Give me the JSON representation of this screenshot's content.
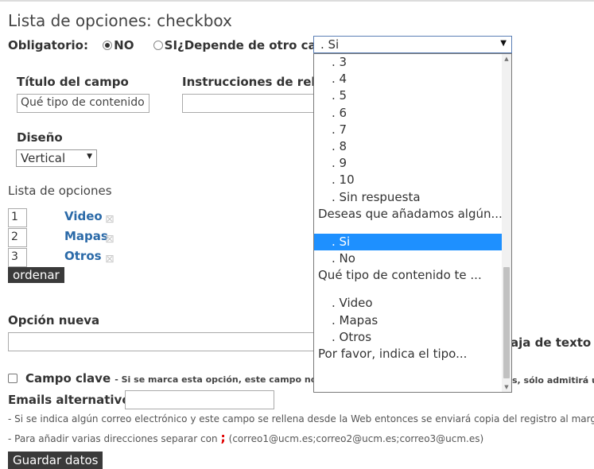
{
  "page": {
    "title": "Lista de opciones: checkbox"
  },
  "required": {
    "label": "Obligatorio:",
    "no_label": "NO",
    "si_label": "SI",
    "selected": "NO"
  },
  "depends": {
    "label": "¿Depende de otro campo?:",
    "selected": ". Si"
  },
  "field_title": {
    "label": "Título del campo",
    "value": "Qué tipo de contenido"
  },
  "instructions": {
    "label": "Instrucciones de rellen",
    "value": ""
  },
  "design": {
    "label": "Diseño",
    "value": "Vertical"
  },
  "options_list": {
    "label": "Lista de opciones",
    "items": [
      {
        "order": "1",
        "label": "Video"
      },
      {
        "order": "2",
        "label": "Mapas"
      },
      {
        "order": "3",
        "label": "Otros"
      }
    ],
    "delete_icon": "close-icon",
    "sort_button": "ordenar"
  },
  "new_option": {
    "label": "Opción nueva",
    "value": "",
    "side_text": "aja de texto"
  },
  "key_field": {
    "label": "Campo clave",
    "note": "- Si se marca esta opción, este campo no adr",
    "note_tail": "s, sólo admitirá ur",
    "checked": false
  },
  "alt_emails": {
    "label": "Emails alternativos",
    "value": "",
    "note1": "- Si se indica algún correo electrónico y este campo se rellena desde la Web entonces se enviará copia del registro al margen",
    "note2_prefix": "- Para añadir varias direcciones separar con",
    "note2_sep": ";",
    "note2_suffix": "(correo1@ucm.es;correo2@ucm.es;correo3@ucm.es)"
  },
  "save_button": "Guardar datos",
  "dropdown": {
    "items": [
      {
        "text": ". 3",
        "kind": "opt"
      },
      {
        "text": ". 4",
        "kind": "opt"
      },
      {
        "text": ". 5",
        "kind": "opt"
      },
      {
        "text": ". 6",
        "kind": "opt"
      },
      {
        "text": ". 7",
        "kind": "opt"
      },
      {
        "text": ". 8",
        "kind": "opt"
      },
      {
        "text": ". 9",
        "kind": "opt"
      },
      {
        "text": ". 10",
        "kind": "opt"
      },
      {
        "text": ". Sin respuesta",
        "kind": "opt"
      },
      {
        "text": "Deseas que añadamos algún...",
        "kind": "group"
      },
      {
        "text": "",
        "kind": "blank"
      },
      {
        "text": ". Si",
        "kind": "opt",
        "selected": true
      },
      {
        "text": ". No",
        "kind": "opt"
      },
      {
        "text": "Qué tipo de contenido te ...",
        "kind": "group"
      },
      {
        "text": "",
        "kind": "blank"
      },
      {
        "text": ". Video",
        "kind": "opt"
      },
      {
        "text": ". Mapas",
        "kind": "opt"
      },
      {
        "text": ". Otros",
        "kind": "opt"
      },
      {
        "text": "Por favor, indica el tipo...",
        "kind": "group"
      }
    ]
  },
  "colors": {
    "accent_link": "#2b6aa8",
    "selected_bg": "#1e90ff",
    "required_mark": "#e00000"
  }
}
